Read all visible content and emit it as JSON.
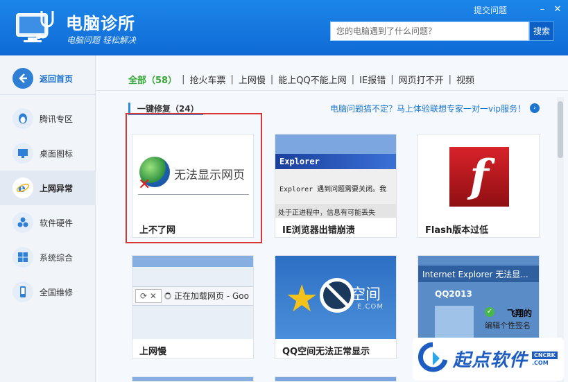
{
  "app": {
    "title": "电脑诊所",
    "subtitle": "电脑问题 轻松解决"
  },
  "window": {
    "feedback": "提交问题",
    "minimize": "–",
    "close": "✕"
  },
  "search": {
    "placeholder": "您的电脑遇到了什么问题？",
    "button": "搜索"
  },
  "sidebar": {
    "home": "返回首页",
    "items": [
      {
        "label": "腾讯专区",
        "icon": "penguin-icon"
      },
      {
        "label": "桌面图标",
        "icon": "monitor-icon"
      },
      {
        "label": "上网异常",
        "icon": "ie-icon"
      },
      {
        "label": "软件硬件",
        "icon": "puzzle-icon"
      },
      {
        "label": "系统综合",
        "icon": "windows-icon"
      },
      {
        "label": "全国维修",
        "icon": "phone-icon"
      }
    ],
    "active_index": 2
  },
  "tabs": [
    {
      "label": "全部（58）",
      "active": true
    },
    {
      "label": "抢火车票"
    },
    {
      "label": "上网慢"
    },
    {
      "label": "能上QQ不能上网"
    },
    {
      "label": "IE报错"
    },
    {
      "label": "网页打不开"
    },
    {
      "label": "视频"
    }
  ],
  "section": {
    "title": "一键修复（24）",
    "vip_link": "电脑问题搞不定？马上体验联想专家一对一vip服务！"
  },
  "cards": [
    {
      "caption": "上不了网",
      "thumb_text": "无法显示网页"
    },
    {
      "caption": "IE浏览器出错崩溃",
      "thumb_title": "Explorer",
      "thumb_text": "Explorer 遇到问题需要关闭。我",
      "thumb_text2": "处于正进程中，信息有可能丢失"
    },
    {
      "caption": "Flash版本过低",
      "thumb_text": "f"
    },
    {
      "caption": "上网慢",
      "thumb_text": "正在加载网页 - Goo"
    },
    {
      "caption": "QQ空间无法正常显示",
      "thumb_text": "空间",
      "thumb_text2": "E.COM"
    },
    {
      "caption": "",
      "thumb_title": "Internet Explorer 无法显...",
      "thumb_text": "QQ2013",
      "thumb_text2": "飞翔的",
      "thumb_text3": "编辑个性签名"
    }
  ],
  "watermark": {
    "text": "起点软件",
    "badge": "CNCRK",
    "com": ".COM"
  },
  "colors": {
    "header": "#0f6ad6",
    "accent": "#3aa53a",
    "highlight": "#d93636"
  }
}
